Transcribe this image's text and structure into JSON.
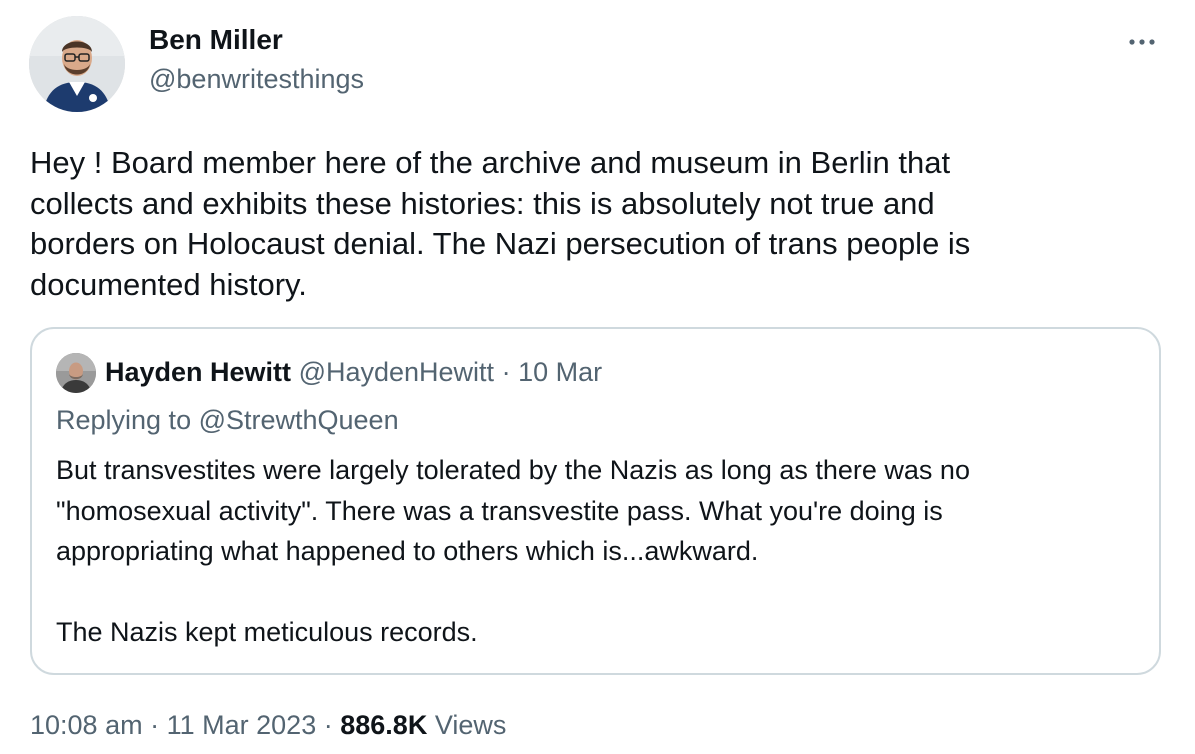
{
  "tweet": {
    "author": {
      "name": "Ben Miller",
      "handle": "@benwritesthings"
    },
    "more_icon": "more-horizontal-icon",
    "text": "Hey ! Board member here of the archive and museum in Berlin that\ncollects and exhibits these histories: this is absolutely not true and\nborders on Holocaust denial. The Nazi persecution of trans people is\ndocumented history.",
    "quote": {
      "author": {
        "name": "Hayden Hewitt",
        "handle": "@HaydenHewitt",
        "separator": "·",
        "date": "10 Mar"
      },
      "replying_to": "Replying to @StrewthQueen",
      "paragraphs": [
        "But transvestites were largely tolerated by the Nazis as long as there was no\n\"homosexual activity\". There was a transvestite pass. What you're doing is\nappropriating what happened to others which is...awkward.",
        "The Nazis kept meticulous records."
      ]
    },
    "meta": {
      "time": "10:08 am",
      "separator": "·",
      "date": "11 Mar 2023",
      "views_count": "886.8K",
      "views_label": "Views"
    }
  }
}
